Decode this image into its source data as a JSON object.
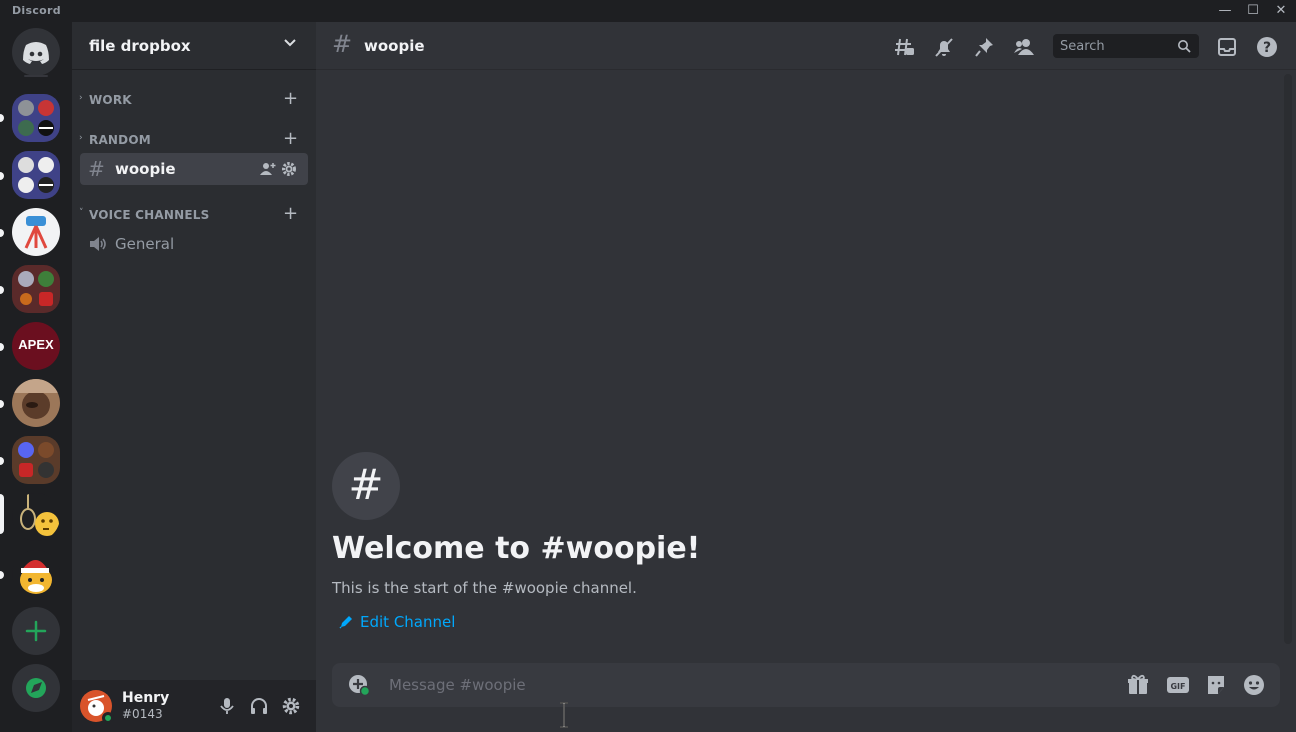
{
  "app": {
    "title": "Discord"
  },
  "window_controls": {
    "minimize": "—",
    "maximize": "☐",
    "close": "✕"
  },
  "server": {
    "name": "file dropbox"
  },
  "categories": [
    {
      "label": "WORK",
      "collapsed": true
    },
    {
      "label": "RANDOM",
      "collapsed": true
    },
    {
      "label": "VOICE CHANNELS",
      "collapsed": false
    }
  ],
  "channels": {
    "text": [
      {
        "name": "woopie",
        "selected": true
      }
    ],
    "voice": [
      {
        "name": "General"
      }
    ]
  },
  "guild_icons": [
    "home-discord-icon",
    "server-folder-1",
    "server-folder-2",
    "server-telescope",
    "server-folder-3",
    "server-apex",
    "server-avatar-person",
    "server-folder-4",
    "server-noose-thinking",
    "server-santa-bee",
    "add-server-icon",
    "explore-icon"
  ],
  "user": {
    "name": "Henry",
    "tag": "#0143",
    "status": "online",
    "status_color": "#23a55a"
  },
  "chat": {
    "channel_name": "woopie",
    "search_placeholder": "Search",
    "welcome_title": "Welcome to #woopie!",
    "welcome_subtitle": "This is the start of the #woopie channel.",
    "edit_channel_label": "Edit Channel",
    "message_placeholder": "Message #woopie"
  },
  "colors": {
    "accent_link": "#00a8fc",
    "green": "#23a55a",
    "blurple": "#5865f2"
  }
}
